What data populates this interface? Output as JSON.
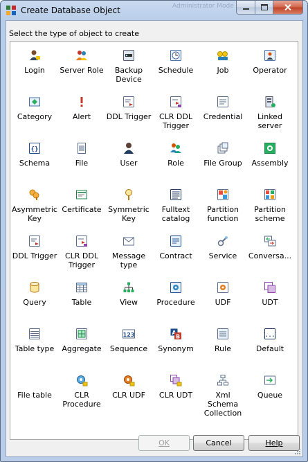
{
  "window": {
    "title": "Create Database Object",
    "ghost_title": "Administrator Mode"
  },
  "prompt": "Select the type of object to create",
  "objects": [
    {
      "label": "Login",
      "icon": "login-icon"
    },
    {
      "label": "Server Role",
      "icon": "server-role-icon"
    },
    {
      "label": "Backup Device",
      "icon": "backup-device-icon"
    },
    {
      "label": "Schedule",
      "icon": "schedule-icon"
    },
    {
      "label": "Job",
      "icon": "job-icon"
    },
    {
      "label": "Operator",
      "icon": "operator-icon"
    },
    {
      "label": "Category",
      "icon": "category-icon"
    },
    {
      "label": "Alert",
      "icon": "alert-icon"
    },
    {
      "label": "DDL Trigger",
      "icon": "ddl-trigger-icon"
    },
    {
      "label": "CLR DDL Trigger",
      "icon": "clr-ddl-trigger-icon"
    },
    {
      "label": "Credential",
      "icon": "credential-icon"
    },
    {
      "label": "Linked server",
      "icon": "linked-server-icon"
    },
    {
      "label": "Schema",
      "icon": "schema-icon"
    },
    {
      "label": "File",
      "icon": "file-icon"
    },
    {
      "label": "User",
      "icon": "user-icon"
    },
    {
      "label": "Role",
      "icon": "role-icon"
    },
    {
      "label": "File Group",
      "icon": "file-group-icon"
    },
    {
      "label": "Assembly",
      "icon": "assembly-icon"
    },
    {
      "label": "Asymmetric Key",
      "icon": "asymmetric-key-icon"
    },
    {
      "label": "Certificate",
      "icon": "certificate-icon"
    },
    {
      "label": "Symmetric Key",
      "icon": "symmetric-key-icon"
    },
    {
      "label": "Fulltext catalog",
      "icon": "fulltext-catalog-icon"
    },
    {
      "label": "Partition function",
      "icon": "partition-function-icon"
    },
    {
      "label": "Partition scheme",
      "icon": "partition-scheme-icon"
    },
    {
      "label": "DDL Trigger",
      "icon": "ddl-trigger-icon"
    },
    {
      "label": "CLR DDL Trigger",
      "icon": "clr-ddl-trigger-icon"
    },
    {
      "label": "Message type",
      "icon": "message-type-icon"
    },
    {
      "label": "Contract",
      "icon": "contract-icon"
    },
    {
      "label": "Service",
      "icon": "service-icon"
    },
    {
      "label": "Conversa...",
      "icon": "conversation-icon"
    },
    {
      "label": "Query",
      "icon": "query-icon"
    },
    {
      "label": "Table",
      "icon": "table-icon"
    },
    {
      "label": "View",
      "icon": "view-icon"
    },
    {
      "label": "Procedure",
      "icon": "procedure-icon"
    },
    {
      "label": "UDF",
      "icon": "udf-icon"
    },
    {
      "label": "UDT",
      "icon": "udt-icon"
    },
    {
      "label": "Table type",
      "icon": "table-type-icon"
    },
    {
      "label": "Aggregate",
      "icon": "aggregate-icon"
    },
    {
      "label": "Sequence",
      "icon": "sequence-icon"
    },
    {
      "label": "Synonym",
      "icon": "synonym-icon"
    },
    {
      "label": "Rule",
      "icon": "rule-icon"
    },
    {
      "label": "Default",
      "icon": "default-icon"
    },
    {
      "label": "File table",
      "icon": "file-table-icon"
    },
    {
      "label": "CLR Procedure",
      "icon": "clr-procedure-icon"
    },
    {
      "label": "CLR UDF",
      "icon": "clr-udf-icon"
    },
    {
      "label": "CLR UDT",
      "icon": "clr-udt-icon"
    },
    {
      "label": "Xml Schema Collection",
      "icon": "xml-schema-collection-icon"
    },
    {
      "label": "Queue",
      "icon": "queue-icon"
    }
  ],
  "buttons": {
    "ok": "OK",
    "cancel": "Cancel",
    "help": "Help"
  },
  "colors": {
    "titlebar": "#b9cde8",
    "close_button": "#c0462a",
    "grid_background": "#ffffff"
  }
}
